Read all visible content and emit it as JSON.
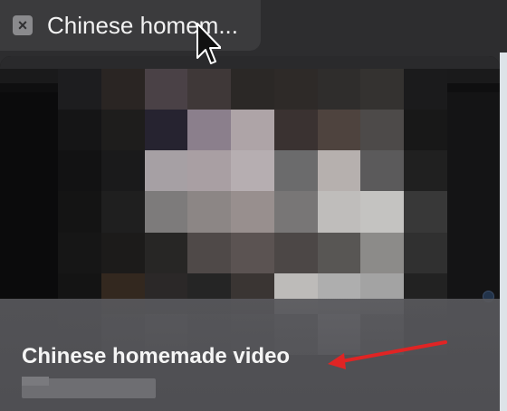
{
  "tab": {
    "close_icon": "close-icon",
    "title": "Chinese homem..."
  },
  "preview": {
    "caption": "Chinese homemade video"
  },
  "colors": {
    "annotation_arrow": "#e02424"
  },
  "mosaic": [
    [
      "#1d1d1f",
      "#2a2523",
      "#4a4146",
      "#3f3838",
      "#2b2826",
      "#2e2a28",
      "#2f2d2c",
      "#343230",
      "#1b1b1c"
    ],
    [
      "#151516",
      "#1e1d1c",
      "#262330",
      "#8b7f8c",
      "#aea4a7",
      "#3a3231",
      "#4e433e",
      "#4d4a49",
      "#181818"
    ],
    [
      "#121213",
      "#1a1a1b",
      "#a6a0a4",
      "#a99fa3",
      "#b6aeb1",
      "#6b6b6c",
      "#b6b0ae",
      "#5b5a5b",
      "#202020"
    ],
    [
      "#141414",
      "#1f1f1f",
      "#7d7b7b",
      "#8c8685",
      "#988f8e",
      "#787676",
      "#bfbdbb",
      "#c4c3c1",
      "#383838"
    ],
    [
      "#161616",
      "#1c1b1a",
      "#272625",
      "#4f4948",
      "#5b5352",
      "#4c4746",
      "#585654",
      "#8c8b89",
      "#303030"
    ],
    [
      "#141414",
      "#33281f",
      "#2b2828",
      "#252525",
      "#3a3533",
      "#bdbbb9",
      "#aeaeae",
      "#a3a3a3",
      "#222222"
    ],
    [
      "#0f0f10",
      "#3a3a3b",
      "#555556",
      "#3b3b3c",
      "#474748",
      "#707072",
      "#d0cfd6",
      "#737376",
      "#1c1c1d"
    ]
  ]
}
